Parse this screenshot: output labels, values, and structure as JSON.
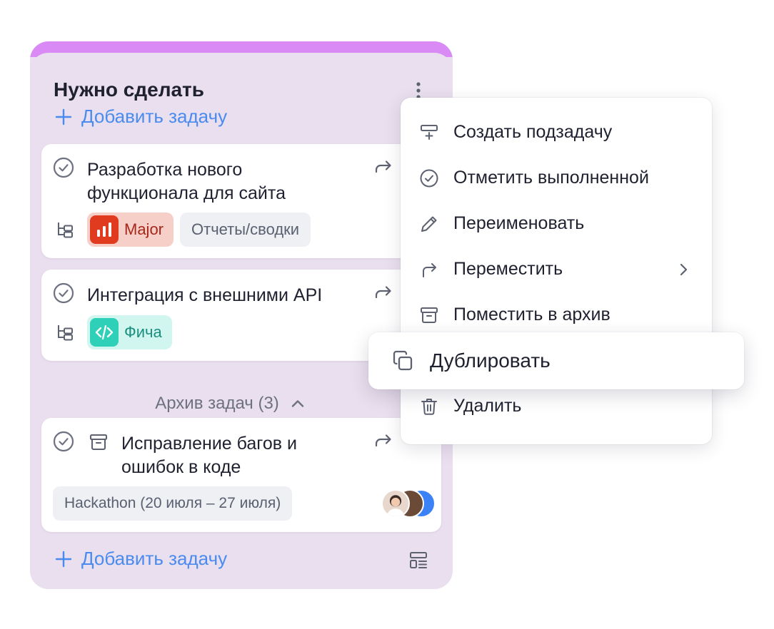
{
  "column": {
    "title": "Нужно сделать",
    "add_task_label": "Добавить задачу",
    "archive_label": "Архив задач (3)"
  },
  "cards": [
    {
      "title_line1": "Разработка нового",
      "title_line2": "функционала для сайта",
      "priority_tag": "Major",
      "category_tag": "Отчеты/сводки"
    },
    {
      "title": "Интеграция с внешними API",
      "type_tag": "Фича"
    },
    {
      "title_line1": "Исправление багов и",
      "title_line2": "ошибок в коде",
      "sprint_tag": "Hackathon (20 июля – 27 июля)"
    }
  ],
  "menu": {
    "items": [
      {
        "label": "Создать подзадачу",
        "icon": "subtask-icon"
      },
      {
        "label": "Отметить выполненной",
        "icon": "check-circle-icon"
      },
      {
        "label": "Переименовать",
        "icon": "pencil-icon"
      },
      {
        "label": "Переместить",
        "icon": "move-arrow-icon"
      },
      {
        "label": "Поместить в архив",
        "icon": "archive-icon"
      },
      {
        "label": "Удалить",
        "icon": "trash-icon"
      }
    ],
    "duplicate_label": "Дублировать"
  },
  "colors": {
    "accent": "#4a8bf0",
    "column_bg": "#e9dfee",
    "column_top": "#d98af5",
    "major": "#e03b1f",
    "feature": "#2fd0b8"
  }
}
